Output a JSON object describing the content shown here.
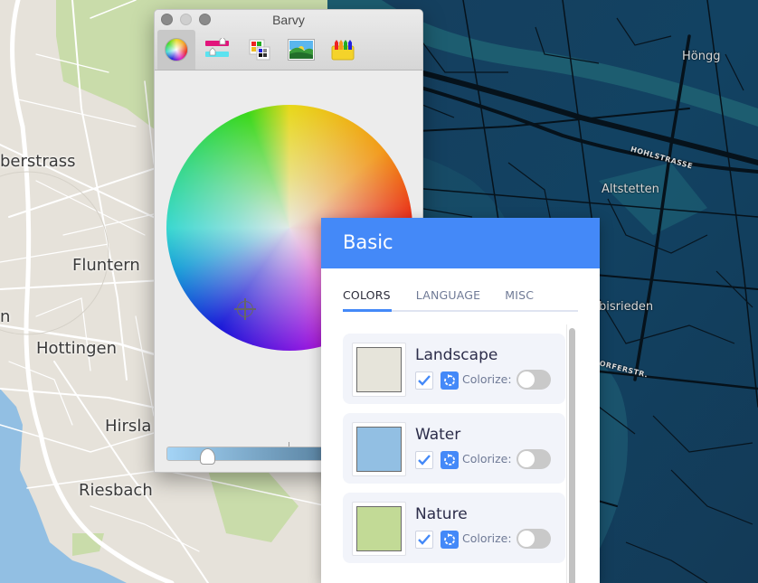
{
  "map": {
    "light_labels": [
      {
        "text": "berstrass"
      },
      {
        "text": "Fluntern"
      },
      {
        "text": "n"
      },
      {
        "text": "Hottingen"
      },
      {
        "text": "Hirsla"
      },
      {
        "text": "Riesbach"
      }
    ],
    "dark_labels": [
      {
        "text": "Höngg"
      },
      {
        "text": "Altstetten"
      },
      {
        "text": "bisrieden"
      }
    ],
    "street_labels": [
      {
        "text": "HOHLSTRASSE"
      },
      {
        "text": "ORFERSTR."
      }
    ],
    "colors": {
      "land_light": "#e6e2da",
      "park": "#c8dba5",
      "lake": "#92bfe3",
      "land_dark": "#143f5c",
      "roads_dark": "#0a1620"
    }
  },
  "color_panel": {
    "title": "Barvy",
    "modes": [
      {
        "name": "color-wheel",
        "active": true
      },
      {
        "name": "color-sliders",
        "active": false
      },
      {
        "name": "color-palettes",
        "active": false
      },
      {
        "name": "image-palettes",
        "active": false
      },
      {
        "name": "crayons",
        "active": false
      }
    ],
    "current_color": "#98c4e6",
    "brightness": 0.2
  },
  "basic_panel": {
    "title": "Basic",
    "tabs": [
      {
        "label": "COLORS",
        "active": true
      },
      {
        "label": "LANGUAGE",
        "active": false
      },
      {
        "label": "MISC",
        "active": false
      }
    ],
    "items": [
      {
        "name": "Landscape",
        "color": "#e6e4da",
        "enabled": true,
        "colorize_label": "Colorize:",
        "colorize": false
      },
      {
        "name": "Water",
        "color": "#92bfe3",
        "enabled": true,
        "colorize_label": "Colorize:",
        "colorize": false
      },
      {
        "name": "Nature",
        "color": "#c2da96",
        "enabled": true,
        "colorize_label": "Colorize:",
        "colorize": false
      }
    ],
    "accent": "#4489f8"
  }
}
